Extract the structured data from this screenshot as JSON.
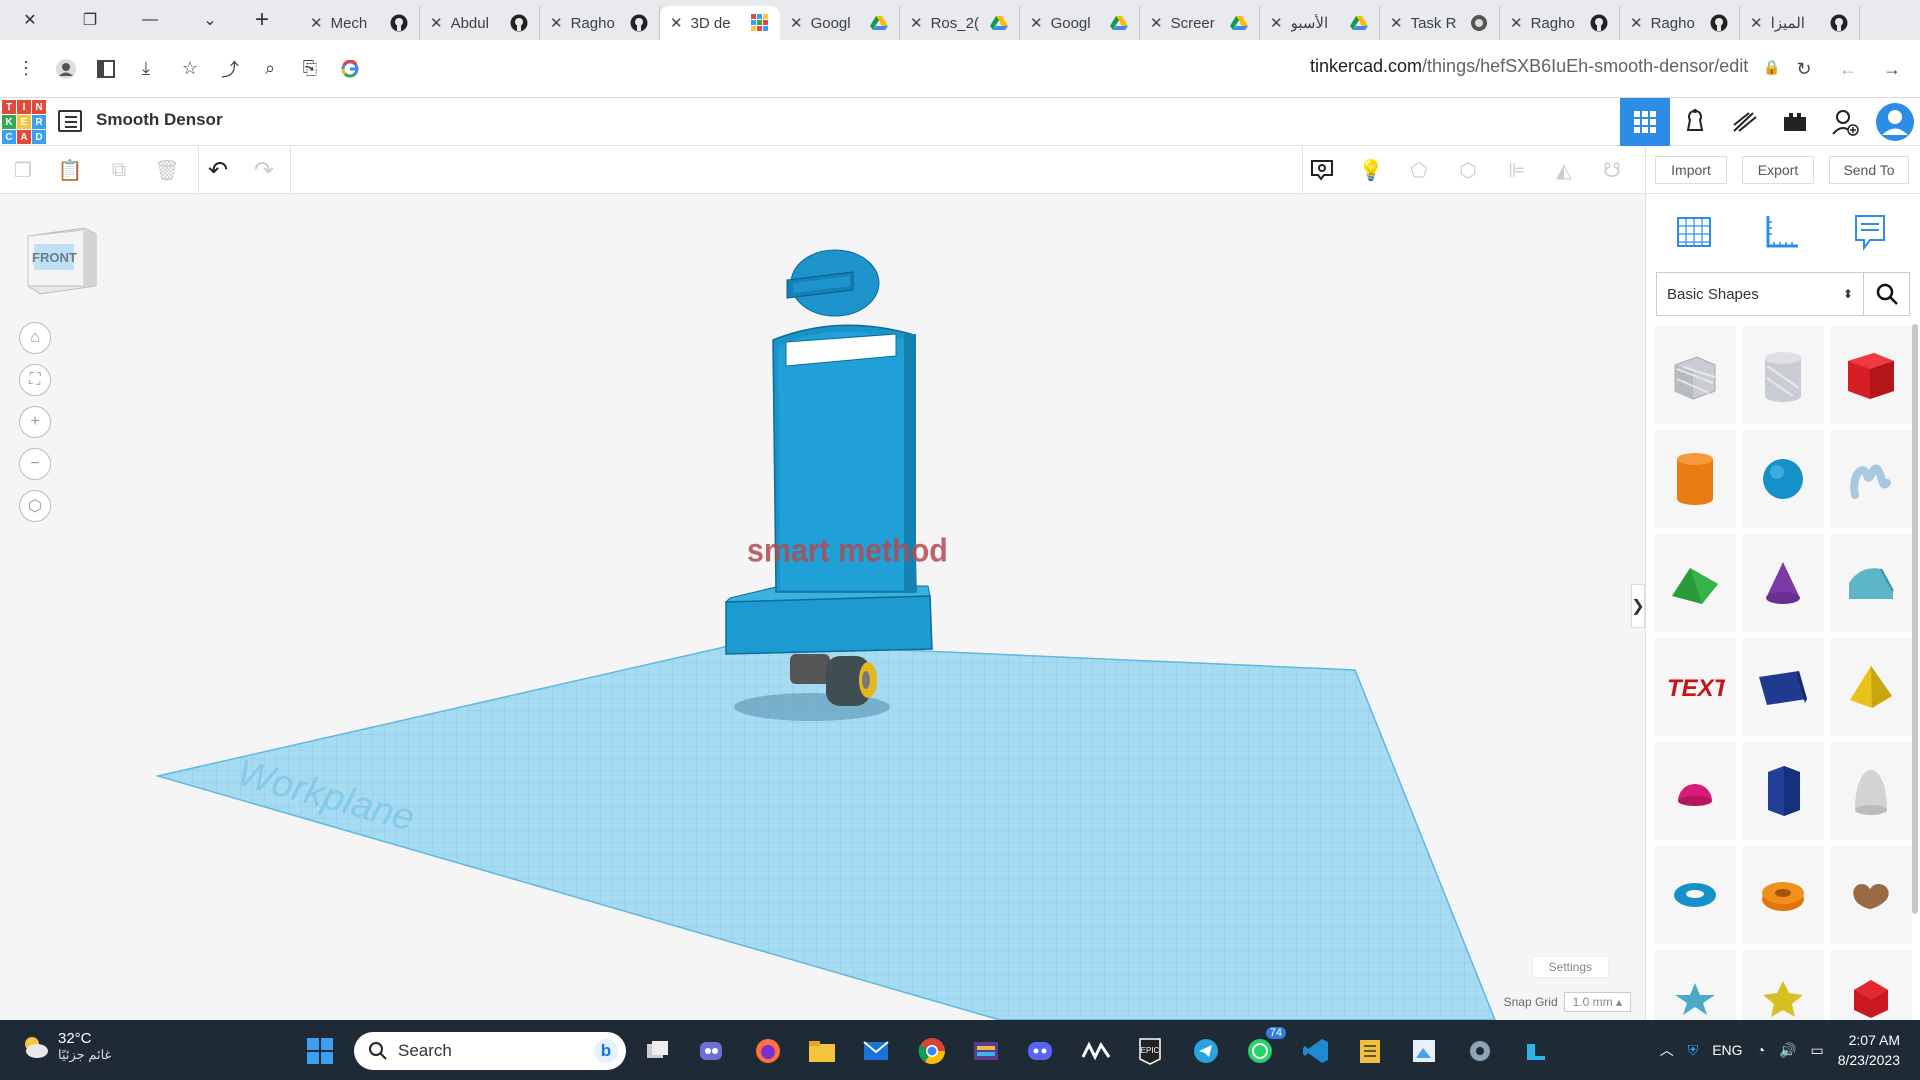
{
  "browser": {
    "tabs": [
      {
        "title": "Mech"
      },
      {
        "title": "Abdul"
      },
      {
        "title": "Ragho"
      },
      {
        "title": "3D de",
        "active": true
      },
      {
        "title": "Googl"
      },
      {
        "title": "Ros_2("
      },
      {
        "title": "Googl"
      },
      {
        "title": "Screer"
      },
      {
        "title": "الأسبو"
      },
      {
        "title": "Task R"
      },
      {
        "title": "Ragho"
      },
      {
        "title": "Ragho"
      },
      {
        "title": "الميزا"
      }
    ],
    "url_host": "tinkercad.com",
    "url_path": "/things/hefSXB6IuEh-smooth-densor/edit"
  },
  "app": {
    "logo_letters": [
      "T",
      "I",
      "N",
      "K",
      "E",
      "R",
      "C",
      "A",
      "D"
    ],
    "design_title": "Smooth Densor",
    "toolbar": {
      "import_label": "Import",
      "export_label": "Export",
      "send_to_label": "Send To"
    }
  },
  "viewport": {
    "viewcube_label": "FRONT",
    "workplane_label": "Workplane",
    "model_text": "smart method",
    "settings_label": "Settings",
    "snap_label": "Snap Grid",
    "snap_value": "1.0 mm"
  },
  "panel": {
    "library": "Basic Shapes",
    "shapes": [
      "box-hole",
      "cylinder-hole",
      "box",
      "cylinder",
      "sphere",
      "scribble",
      "roof",
      "cone",
      "round-roof",
      "text",
      "half-sphere-prism",
      "pyramid",
      "half-sphere",
      "polygon",
      "paraboloid",
      "torus",
      "tube",
      "heart",
      "star",
      "star-3d",
      "icosahedron"
    ]
  },
  "taskbar": {
    "temp": "32°C",
    "weather_desc": "غائم جزئيًا",
    "search_placeholder": "Search",
    "whatsapp_badge": "74",
    "lang": "ENG",
    "time": "2:07 AM",
    "date": "8/23/2023"
  },
  "colors": {
    "accent": "#2c8ce6",
    "model_blue": "#1a90c8",
    "workplane": "#9fd6ef",
    "taskbar": "#1e2a36"
  }
}
